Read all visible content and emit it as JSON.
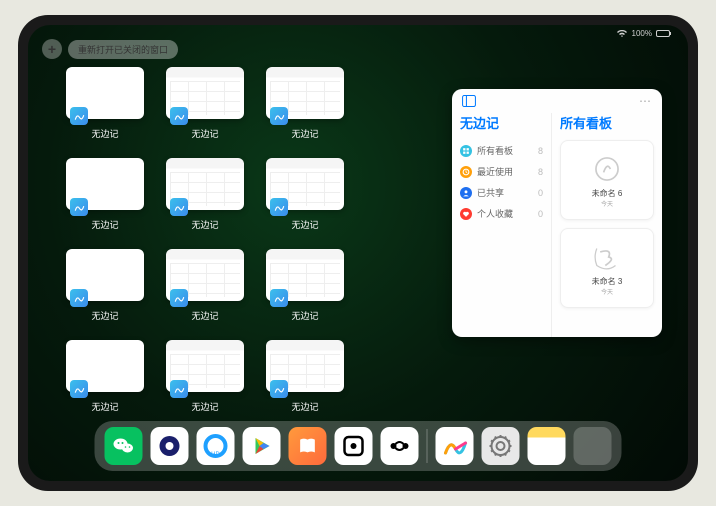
{
  "status": {
    "battery": "100%"
  },
  "top": {
    "plus": "+",
    "reopen_label": "重新打开已关闭的窗口"
  },
  "thumbs": {
    "app_name": "无边记",
    "items": [
      {
        "style": "blank"
      },
      {
        "style": "detail"
      },
      {
        "style": "detail"
      },
      {
        "style": "blank"
      },
      {
        "style": "detail"
      },
      {
        "style": "detail"
      },
      {
        "style": "blank"
      },
      {
        "style": "detail"
      },
      {
        "style": "detail"
      },
      {
        "style": "blank"
      },
      {
        "style": "detail"
      },
      {
        "style": "detail"
      }
    ]
  },
  "panel": {
    "left_title": "无边记",
    "right_title": "所有看板",
    "items": [
      {
        "icon_color": "#34c2e3",
        "label": "所有看板",
        "count": "8"
      },
      {
        "icon_color": "#ff9f0a",
        "label": "最近使用",
        "count": "8"
      },
      {
        "icon_color": "#1e6ff0",
        "label": "已共享",
        "count": "0"
      },
      {
        "icon_color": "#ff3b30",
        "label": "个人收藏",
        "count": "0"
      }
    ],
    "boards": [
      {
        "name": "未命名 6",
        "date": "今天"
      },
      {
        "name": "未命名 3",
        "date": "今天"
      }
    ]
  },
  "dock": {
    "apps": [
      {
        "name": "wechat"
      },
      {
        "name": "quark"
      },
      {
        "name": "browser"
      },
      {
        "name": "play"
      },
      {
        "name": "books"
      },
      {
        "name": "dice"
      },
      {
        "name": "connect"
      }
    ],
    "recent": [
      {
        "name": "freeform"
      },
      {
        "name": "settings"
      },
      {
        "name": "notes"
      },
      {
        "name": "multi"
      }
    ]
  }
}
